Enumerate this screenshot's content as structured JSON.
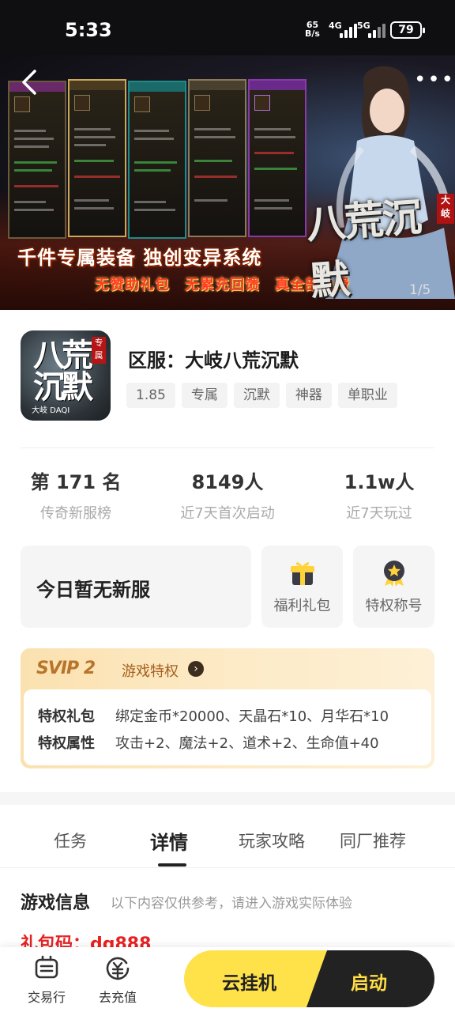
{
  "status_bar": {
    "time": "5:33",
    "speed_value": "65",
    "speed_unit": "B/s",
    "net1": "4G",
    "net2": "5G",
    "battery": "79"
  },
  "banner": {
    "slogan": "千件专属装备 独创变异系统",
    "promo": "无赞助礼包　无累充回馈　真全部免费",
    "logo": "八荒沉默",
    "logo_tag": "大岐",
    "pager": "1/5"
  },
  "game": {
    "icon_title": "八荒沉默",
    "icon_tag": "专属",
    "icon_sub": "大岐 DAQI",
    "title": "区服：大岐八荒沉默",
    "tags": [
      "1.85",
      "专属",
      "沉默",
      "神器",
      "单职业"
    ]
  },
  "stats": [
    {
      "value": "第 171 名",
      "label": "传奇新服榜"
    },
    {
      "value": "8149人",
      "label": "近7天首次启动"
    },
    {
      "value": "1.1w人",
      "label": "近7天玩过"
    }
  ],
  "actions": {
    "no_server": "今日暂无新服",
    "gift": "福利礼包",
    "title_badge": "特权称号"
  },
  "svip": {
    "logo": "SVIP 2",
    "subtitle": "游戏特权",
    "arrow": "›",
    "rows": [
      {
        "label": "特权礼包",
        "value": "绑定金币*20000、天晶石*10、月华石*10"
      },
      {
        "label": "特权属性",
        "value": "攻击+2、魔法+2、道术+2、生命值+40"
      }
    ]
  },
  "tabs": [
    "任务",
    "详情",
    "玩家攻略",
    "同厂推荐"
  ],
  "info": {
    "heading": "游戏信息",
    "note": "以下内容仅供参考，请进入游戏实际体验",
    "gift_code": "礼包码：dq888"
  },
  "bottom": {
    "trade": "交易行",
    "recharge": "去充值",
    "cloud": "云挂机",
    "start": "启动"
  },
  "colors": {
    "accent_yellow": "#ffe14a",
    "dark": "#222222",
    "red": "#e82222",
    "svip_gold": "#b8742a"
  }
}
